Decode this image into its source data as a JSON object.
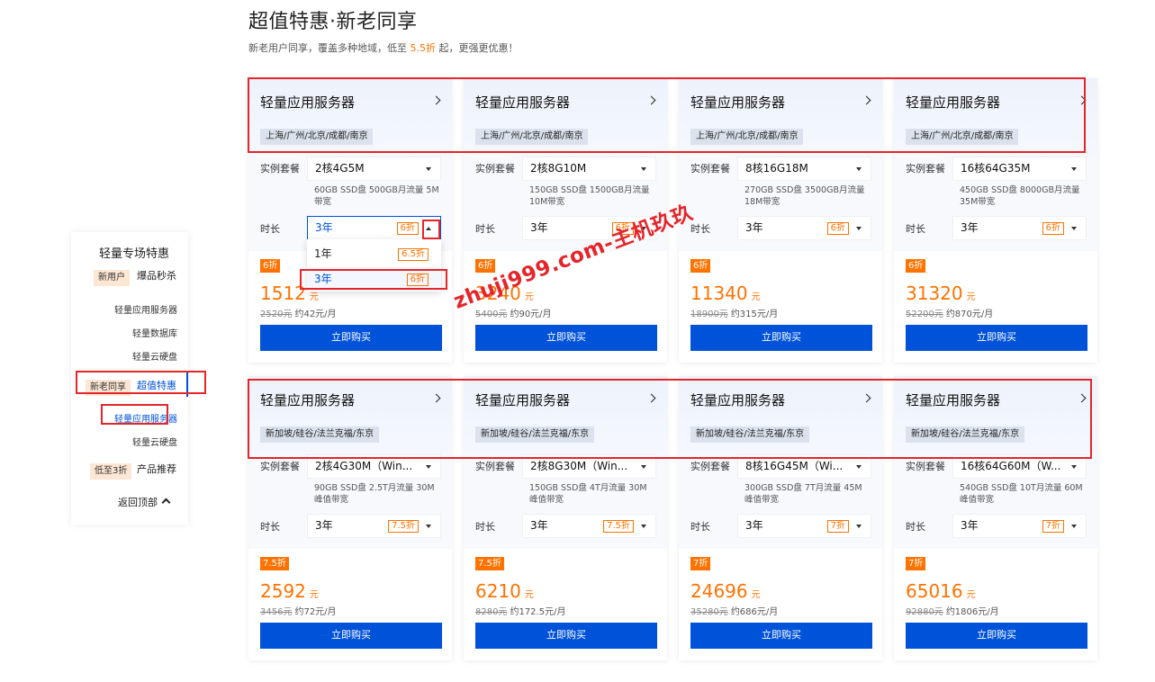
{
  "header": {
    "title": "超值特惠·新老同享",
    "subtitle_pre": "新老用户同享，覆盖多种地域，低至 ",
    "subtitle_highlight": "5.5折",
    "subtitle_post": " 起，更强更优惠！"
  },
  "sidebar": {
    "title": "轻量专场特惠",
    "sections": [
      {
        "tag": "新用户",
        "label": "爆品秒杀",
        "items": [
          "轻量应用服务器",
          "轻量数据库",
          "轻量云硬盘"
        ]
      },
      {
        "tag": "新老同享",
        "label": "超值特惠",
        "items": [
          "轻量应用服务器",
          "轻量云硬盘"
        ]
      },
      {
        "tag": "低至3折",
        "label": "产品推荐",
        "items": []
      }
    ],
    "back_top": "返回顶部"
  },
  "labels": {
    "package": "实例套餐",
    "duration": "时长",
    "buy": "立即购买",
    "currency": "元"
  },
  "cards": [
    {
      "name": "轻量应用服务器",
      "region": "上海/广州/北京/成都/南京",
      "package": "2核4G5M",
      "desc": "60GB SSD盘 500GB月流量 5M带宽",
      "duration": "3年",
      "duration_discount": "6折",
      "badge": "6折",
      "price": "1512",
      "orig_price": "2520元",
      "monthly": "约42元/月"
    },
    {
      "name": "轻量应用服务器",
      "region": "上海/广州/北京/成都/南京",
      "package": "2核8G10M",
      "desc": "150GB SSD盘 1500GB月流量 10M带宽",
      "duration": "3年",
      "duration_discount": "6折",
      "badge": "6折",
      "price": "3240",
      "orig_price": "5400元",
      "monthly": "约90元/月"
    },
    {
      "name": "轻量应用服务器",
      "region": "上海/广州/北京/成都/南京",
      "package": "8核16G18M",
      "desc": "270GB SSD盘 3500GB月流量 18M带宽",
      "duration": "3年",
      "duration_discount": "6折",
      "badge": "6折",
      "price": "11340",
      "orig_price": "18900元",
      "monthly": "约315元/月"
    },
    {
      "name": "轻量应用服务器",
      "region": "上海/广州/北京/成都/南京",
      "package": "16核64G35M",
      "desc": "450GB SSD盘 8000GB月流量 35M带宽",
      "duration": "3年",
      "duration_discount": "6折",
      "badge": "6折",
      "price": "31320",
      "orig_price": "52200元",
      "monthly": "约870元/月"
    },
    {
      "name": "轻量应用服务器",
      "region": "新加坡/硅谷/法兰克福/东京",
      "package": "2核4G30M（Win...",
      "desc": "90GB SSD盘 2.5T月流量 30M峰值带宽",
      "duration": "3年",
      "duration_discount": "7.5折",
      "badge": "7.5折",
      "price": "2592",
      "orig_price": "3456元",
      "monthly": "约72元/月"
    },
    {
      "name": "轻量应用服务器",
      "region": "新加坡/硅谷/法兰克福/东京",
      "package": "2核8G30M（Win...",
      "desc": "150GB SSD盘 4T月流量 30M峰值带宽",
      "duration": "3年",
      "duration_discount": "7.5折",
      "badge": "7.5折",
      "price": "6210",
      "orig_price": "8280元",
      "monthly": "约172.5元/月"
    },
    {
      "name": "轻量应用服务器",
      "region": "新加坡/硅谷/法兰克福/东京",
      "package": "8核16G45M（Wi...",
      "desc": "300GB SSD盘 7T月流量 45M峰值带宽",
      "duration": "3年",
      "duration_discount": "7折",
      "badge": "7折",
      "price": "24696",
      "orig_price": "35280元",
      "monthly": "约686元/月"
    },
    {
      "name": "轻量应用服务器",
      "region": "新加坡/硅谷/法兰克福/东京",
      "package": "16核64G60M（W...",
      "desc": "540GB SSD盘 10T月流量 60M峰值带宽",
      "duration": "3年",
      "duration_discount": "7折",
      "badge": "7折",
      "price": "65016",
      "orig_price": "92880元",
      "monthly": "约1806元/月"
    }
  ],
  "dropdown": {
    "options": [
      {
        "label": "1年",
        "discount": "6.5折"
      },
      {
        "label": "3年",
        "discount": "6折"
      }
    ]
  },
  "watermark": "zhuji999.com-主机玖玖",
  "colors": {
    "accent": "#0052d9",
    "discount": "#ff7200",
    "annotation": "#e5252a"
  }
}
